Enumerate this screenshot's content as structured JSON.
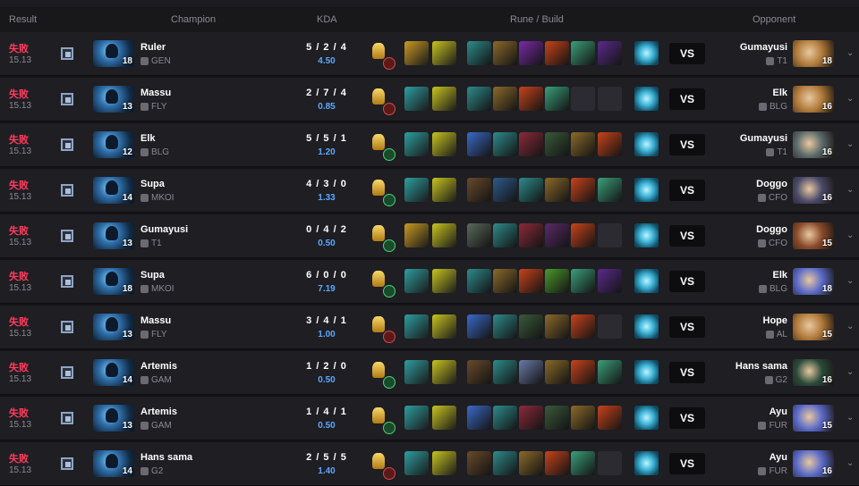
{
  "header": {
    "result": "Result",
    "champion": "Champion",
    "kda": "KDA",
    "build": "Rune / Build",
    "opponent": "Opponent"
  },
  "colors": {
    "loss": "#ff3d5e",
    "ratio": "#5ea8ff"
  },
  "rows": [
    {
      "result": "失败",
      "patch": "15.13",
      "level": "18",
      "player": "Ruler",
      "team": "GEN",
      "kda": "5 / 2 / 4",
      "ratio": "4.50",
      "rune": "red",
      "spells": [
        "#c99a24",
        "#c8c420"
      ],
      "items": [
        "#2e8c8c",
        "#8c6a2a",
        "#7a2aa8",
        "#c8431a",
        "#3aa07a",
        "#5a2a8c"
      ],
      "opp": "Gumayusi",
      "oppTeam": "T1",
      "oppLevel": "18",
      "oppColor": "#b07a3a"
    },
    {
      "result": "失败",
      "patch": "15.13",
      "level": "13",
      "player": "Massu",
      "team": "FLY",
      "kda": "2 / 7 / 4",
      "ratio": "0.85",
      "rune": "red",
      "spells": [
        "#2e9ea0",
        "#c8c420"
      ],
      "items": [
        "#2e8c8c",
        "#8c6a2a",
        "#c8431a",
        "#3aa07a",
        "",
        ""
      ],
      "opp": "Elk",
      "oppTeam": "BLG",
      "oppLevel": "16",
      "oppColor": "#b07a3a"
    },
    {
      "result": "失败",
      "patch": "15.13",
      "level": "12",
      "player": "Elk",
      "team": "BLG",
      "kda": "5 / 5 / 1",
      "ratio": "1.20",
      "rune": "green",
      "spells": [
        "#2e9ea0",
        "#c8c420"
      ],
      "items": [
        "#3a6ac8",
        "#2e8c8c",
        "#8c2a3a",
        "#3a5a3a",
        "#8c6a2a",
        "#c8431a"
      ],
      "opp": "Gumayusi",
      "oppTeam": "T1",
      "oppLevel": "16",
      "oppColor": "#5a6a6a"
    },
    {
      "result": "失败",
      "patch": "15.13",
      "level": "14",
      "player": "Supa",
      "team": "MKOI",
      "kda": "4 / 3 / 0",
      "ratio": "1.33",
      "rune": "green",
      "spells": [
        "#2e9ea0",
        "#c8c420"
      ],
      "items": [
        "#6a4a2a",
        "#2e5a8c",
        "#2e8c8c",
        "#8c6a2a",
        "#c8431a",
        "#3aa07a"
      ],
      "opp": "Doggo",
      "oppTeam": "CFO",
      "oppLevel": "16",
      "oppColor": "#4a4a6a"
    },
    {
      "result": "失败",
      "patch": "15.13",
      "level": "13",
      "player": "Gumayusi",
      "team": "T1",
      "kda": "0 / 4 / 2",
      "ratio": "0.50",
      "rune": "green",
      "spells": [
        "#c99a24",
        "#c8c420"
      ],
      "items": [
        "#5a6a5a",
        "#2e8c8c",
        "#8c2a3a",
        "#5a2a6a",
        "#c8431a",
        ""
      ],
      "opp": "Doggo",
      "oppTeam": "CFO",
      "oppLevel": "15",
      "oppColor": "#8a4a2a"
    },
    {
      "result": "失败",
      "patch": "15.13",
      "level": "18",
      "player": "Supa",
      "team": "MKOI",
      "kda": "6 / 0 / 0",
      "ratio": "7.19",
      "rune": "green",
      "spells": [
        "#2e9ea0",
        "#c8c420"
      ],
      "items": [
        "#2e8c8c",
        "#8c6a2a",
        "#c8431a",
        "#4a9a2a",
        "#3aa07a",
        "#5a2a8c"
      ],
      "opp": "Elk",
      "oppTeam": "BLG",
      "oppLevel": "18",
      "oppColor": "#5a6ac8"
    },
    {
      "result": "失败",
      "patch": "15.13",
      "level": "13",
      "player": "Massu",
      "team": "FLY",
      "kda": "3 / 4 / 1",
      "ratio": "1.00",
      "rune": "red",
      "spells": [
        "#2e9ea0",
        "#c8c420"
      ],
      "items": [
        "#3a6ac8",
        "#2e8c8c",
        "#3a5a3a",
        "#8c6a2a",
        "#c8431a",
        ""
      ],
      "opp": "Hope",
      "oppTeam": "AL",
      "oppLevel": "15",
      "oppColor": "#b07a3a"
    },
    {
      "result": "失败",
      "patch": "15.13",
      "level": "14",
      "player": "Artemis",
      "team": "GAM",
      "kda": "1 / 2 / 0",
      "ratio": "0.50",
      "rune": "green",
      "spells": [
        "#2e9ea0",
        "#c8c420"
      ],
      "items": [
        "#6a4a2a",
        "#2e8c8c",
        "#6a7aa8",
        "#8c6a2a",
        "#c8431a",
        "#3aa07a"
      ],
      "opp": "Hans sama",
      "oppTeam": "G2",
      "oppLevel": "16",
      "oppColor": "#2a4a3a"
    },
    {
      "result": "失败",
      "patch": "15.13",
      "level": "13",
      "player": "Artemis",
      "team": "GAM",
      "kda": "1 / 4 / 1",
      "ratio": "0.50",
      "rune": "green",
      "spells": [
        "#2e9ea0",
        "#c8c420"
      ],
      "items": [
        "#3a6ac8",
        "#2e8c8c",
        "#8c2a3a",
        "#3a5a3a",
        "#8c6a2a",
        "#c8431a"
      ],
      "opp": "Ayu",
      "oppTeam": "FUR",
      "oppLevel": "15",
      "oppColor": "#5a6ac8"
    },
    {
      "result": "失败",
      "patch": "15.13",
      "level": "14",
      "player": "Hans sama",
      "team": "G2",
      "kda": "2 / 5 / 5",
      "ratio": "1.40",
      "rune": "red",
      "spells": [
        "#2e9ea0",
        "#c8c420"
      ],
      "items": [
        "#6a4a2a",
        "#2e8c8c",
        "#8c6a2a",
        "#c8431a",
        "#3aa07a",
        ""
      ],
      "opp": "Ayu",
      "oppTeam": "FUR",
      "oppLevel": "16",
      "oppColor": "#5a6ac8"
    }
  ]
}
